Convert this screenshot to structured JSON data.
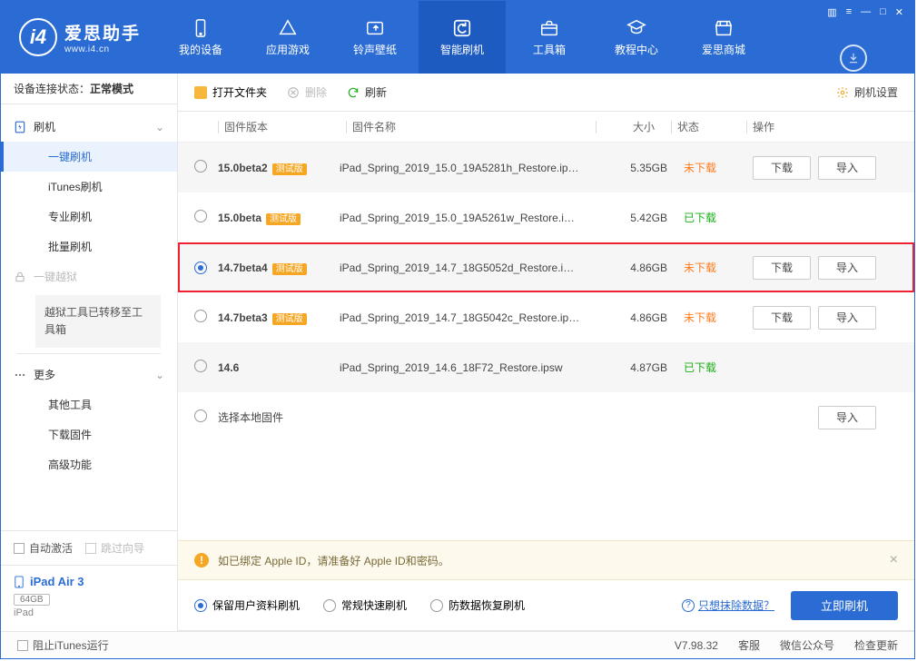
{
  "brand": {
    "cn": "爱思助手",
    "en": "www.i4.cn"
  },
  "nav": [
    {
      "label": "我的设备",
      "icon": "device"
    },
    {
      "label": "应用游戏",
      "icon": "apps"
    },
    {
      "label": "铃声壁纸",
      "icon": "media"
    },
    {
      "label": "智能刷机",
      "icon": "flash",
      "active": true
    },
    {
      "label": "工具箱",
      "icon": "toolbox"
    },
    {
      "label": "教程中心",
      "icon": "tutorial"
    },
    {
      "label": "爱思商城",
      "icon": "store"
    }
  ],
  "conn": {
    "prefix": "设备连接状态：",
    "mode": "正常模式"
  },
  "sidebar": {
    "cat1": "刷机",
    "items1": [
      "一键刷机",
      "iTunes刷机",
      "专业刷机",
      "批量刷机"
    ],
    "cat2": "一键越狱",
    "note": "越狱工具已转移至工具箱",
    "cat3": "更多",
    "items3": [
      "其他工具",
      "下载固件",
      "高级功能"
    ]
  },
  "side_bottom": {
    "auto_activate": "自动激活",
    "skip_guide": "跳过向导",
    "device_name": "iPad Air 3",
    "device_cap": "64GB",
    "device_type": "iPad"
  },
  "toolbar": {
    "open": "打开文件夹",
    "delete": "删除",
    "refresh": "刷新",
    "settings": "刷机设置"
  },
  "columns": {
    "version": "固件版本",
    "name": "固件名称",
    "size": "大小",
    "status": "状态",
    "ops": "操作"
  },
  "badge": "测试版",
  "status_no": "未下载",
  "status_yes": "已下载",
  "btn_download": "下载",
  "btn_import": "导入",
  "rows": [
    {
      "version": "15.0beta2",
      "beta": true,
      "name": "iPad_Spring_2019_15.0_19A5281h_Restore.ip…",
      "size": "5.35GB",
      "downloaded": false,
      "ops": true,
      "selected": false
    },
    {
      "version": "15.0beta",
      "beta": true,
      "name": "iPad_Spring_2019_15.0_19A5261w_Restore.i…",
      "size": "5.42GB",
      "downloaded": true,
      "ops": false,
      "selected": false
    },
    {
      "version": "14.7beta4",
      "beta": true,
      "name": "iPad_Spring_2019_14.7_18G5052d_Restore.i…",
      "size": "4.86GB",
      "downloaded": false,
      "ops": true,
      "selected": true,
      "highlight": true
    },
    {
      "version": "14.7beta3",
      "beta": true,
      "name": "iPad_Spring_2019_14.7_18G5042c_Restore.ip…",
      "size": "4.86GB",
      "downloaded": false,
      "ops": true,
      "selected": false
    },
    {
      "version": "14.6",
      "beta": false,
      "name": "iPad_Spring_2019_14.6_18F72_Restore.ipsw",
      "size": "4.87GB",
      "downloaded": true,
      "ops": false,
      "selected": false
    }
  ],
  "local_row": "选择本地固件",
  "info": "如已绑定 Apple ID，请准备好 Apple ID和密码。",
  "modes": {
    "keep": "保留用户资料刷机",
    "fast": "常规快速刷机",
    "anti": "防数据恢复刷机",
    "erase_link": "只想抹除数据？",
    "flash_btn": "立即刷机"
  },
  "footer": {
    "block_itunes": "阻止iTunes运行",
    "version": "V7.98.32",
    "kefu": "客服",
    "wechat": "微信公众号",
    "update": "检查更新"
  }
}
